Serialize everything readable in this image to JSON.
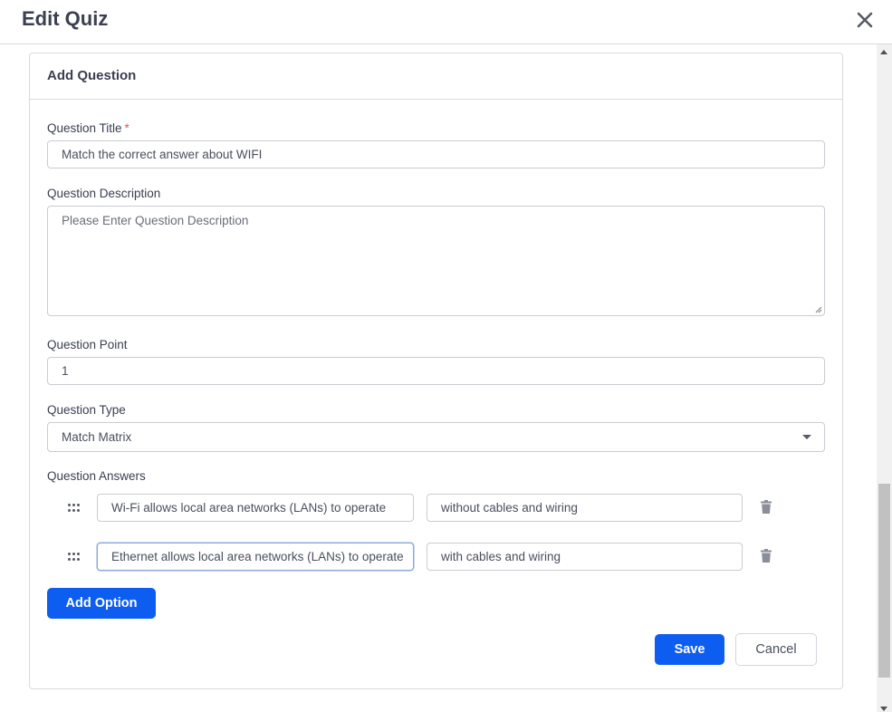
{
  "modal": {
    "title": "Edit Quiz",
    "close_icon": "close-icon"
  },
  "card": {
    "title": "Add Question"
  },
  "question_title": {
    "label": "Question Title",
    "required_mark": "*",
    "value": "Match the correct answer about WIFI"
  },
  "question_description": {
    "label": "Question Description",
    "placeholder": "Please Enter Question Description",
    "value": ""
  },
  "question_point": {
    "label": "Question Point",
    "value": "1"
  },
  "question_type": {
    "label": "Question Type",
    "selected": "Match Matrix"
  },
  "question_answers": {
    "label": "Question Answers",
    "rows": [
      {
        "left": "Wi-Fi allows local area networks (LANs) to operate",
        "right": "without cables and wiring"
      },
      {
        "left": "Ethernet allows local area networks (LANs) to operate",
        "right": "with cables and wiring"
      }
    ]
  },
  "buttons": {
    "add_option": "Add Option",
    "save": "Save",
    "cancel": "Cancel"
  },
  "colors": {
    "primary": "#0d5ef0",
    "required": "#e55353",
    "border": "#c9ccd3"
  }
}
